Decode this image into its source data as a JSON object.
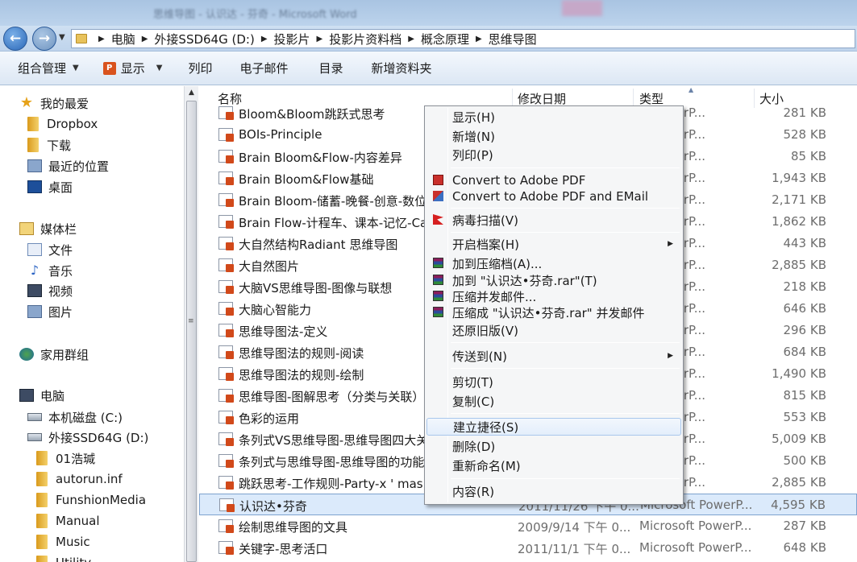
{
  "window": {
    "title": "思维导图 - 认识达 - 芬奇 - Microsoft Word"
  },
  "address": {
    "crumbs": [
      "电脑",
      "外接SSD64G (D:)",
      "投影片",
      "投影片资料档",
      "概念原理",
      "思维导图"
    ]
  },
  "toolbar": {
    "organize": "组合管理",
    "show": "显示",
    "print": "列印",
    "email": "电子邮件",
    "burn": "目录",
    "new_folder": "新增资料夹"
  },
  "sidebar": {
    "items": [
      {
        "label": "我的最爱",
        "icon": "star-icon"
      },
      {
        "label": "Dropbox",
        "icon": "folder-icon"
      },
      {
        "label": "下载",
        "icon": "folder-icon"
      },
      {
        "label": "最近的位置",
        "icon": "recent-places-icon"
      },
      {
        "label": "桌面",
        "icon": "desktop-icon"
      },
      {
        "label": "媒体栏",
        "icon": "library-icon"
      },
      {
        "label": "文件",
        "icon": "documents-icon"
      },
      {
        "label": "音乐",
        "icon": "music-icon"
      },
      {
        "label": "视频",
        "icon": "video-icon"
      },
      {
        "label": "图片",
        "icon": "pictures-icon"
      },
      {
        "label": "家用群组",
        "icon": "homegroup-icon"
      },
      {
        "label": "电脑",
        "icon": "computer-icon"
      },
      {
        "label": "本机磁盘 (C:)",
        "icon": "drive-icon"
      },
      {
        "label": "外接SSD64G (D:)",
        "icon": "drive-icon"
      },
      {
        "label": "01浩瑊",
        "icon": "folder-icon"
      },
      {
        "label": "autorun.inf",
        "icon": "folder-icon"
      },
      {
        "label": "FunshionMedia",
        "icon": "folder-icon"
      },
      {
        "label": "Manual",
        "icon": "folder-icon"
      },
      {
        "label": "Music",
        "icon": "folder-icon"
      },
      {
        "label": "Utility",
        "icon": "folder-icon"
      }
    ]
  },
  "columns": {
    "name": "名称",
    "date": "修改日期",
    "type": "类型",
    "size": "大小"
  },
  "files": [
    {
      "name": "Bloom&Bloom跳跃式思考",
      "date": "",
      "type": "ft PowerP...",
      "size": "281 KB"
    },
    {
      "name": "BOIs-Principle",
      "date": "",
      "type": "ft PowerP...",
      "size": "528 KB"
    },
    {
      "name": "Brain Bloom&Flow-内容差异",
      "date": "",
      "type": "ft PowerP...",
      "size": "85 KB"
    },
    {
      "name": "Brain Bloom&Flow基础",
      "date": "",
      "type": "ft PowerP...",
      "size": "1,943 KB"
    },
    {
      "name": "Brain Bloom-储蓄-晚餐-创意-数位",
      "date": "",
      "type": "ft PowerP...",
      "size": "2,171 KB"
    },
    {
      "name": "Brain Flow-计程车、课本-记忆-Ca",
      "date": "",
      "type": "ft PowerP...",
      "size": "1,862 KB"
    },
    {
      "name": "大自然结构Radiant 思维导图",
      "date": "",
      "type": "ft PowerP...",
      "size": "443 KB"
    },
    {
      "name": "大自然图片",
      "date": "",
      "type": "ft PowerP...",
      "size": "2,885 KB"
    },
    {
      "name": "大脑VS思维导图-图像与联想",
      "date": "",
      "type": "ft PowerP...",
      "size": "218 KB"
    },
    {
      "name": "大脑心智能力",
      "date": "",
      "type": "ft PowerP...",
      "size": "646 KB"
    },
    {
      "name": "思维导图法-定义",
      "date": "",
      "type": "ft PowerP...",
      "size": "296 KB"
    },
    {
      "name": "思维导图法的规则-阅读",
      "date": "",
      "type": "ft PowerP...",
      "size": "684 KB"
    },
    {
      "name": "思维导图法的规则-绘制",
      "date": "",
      "type": "ft PowerP...",
      "size": "1,490 KB"
    },
    {
      "name": "思维导图-图解思考（分类与关联）",
      "date": "",
      "type": "ft PowerP...",
      "size": "815 KB"
    },
    {
      "name": "色彩的运用",
      "date": "",
      "type": "ft PowerP...",
      "size": "553 KB"
    },
    {
      "name": "条列式VS思维导图-思维导图四大关",
      "date": "",
      "type": "ft PowerP...",
      "size": "5,009 KB"
    },
    {
      "name": "条列式与思维导图-思维导图的功能",
      "date": "",
      "type": "ft PowerP...",
      "size": "500 KB"
    },
    {
      "name": "跳跃思考-工作规则-Party-x ' mas",
      "date": "",
      "type": "ft PowerP...",
      "size": "2,885 KB"
    },
    {
      "name": "认识达•芬奇",
      "date": "2011/11/26 下午 0...",
      "type": "Microsoft PowerP...",
      "size": "4,595 KB",
      "selected": true
    },
    {
      "name": "绘制思维导图的文具",
      "date": "2009/9/14 下午 0...",
      "type": "Microsoft PowerP...",
      "size": "287 KB"
    },
    {
      "name": "关键字-思考活口",
      "date": "2011/11/1 下午 0...",
      "type": "Microsoft PowerP...",
      "size": "648 KB"
    }
  ],
  "context_menu": {
    "items": [
      {
        "label": "显示(H)",
        "name": "menu-show"
      },
      {
        "label": "新增(N)",
        "name": "menu-new"
      },
      {
        "label": "列印(P)",
        "name": "menu-print"
      },
      {
        "label": "Convert to Adobe PDF",
        "name": "menu-convert-pdf",
        "icon": "pdf-icon"
      },
      {
        "label": "Convert to Adobe PDF and EMail",
        "name": "menu-convert-pdf-email",
        "icon": "pdf-email-icon"
      },
      {
        "label": "病毒扫描(V)",
        "name": "menu-virus-scan",
        "icon": "antivirus-icon"
      },
      {
        "label": "开启档案(H)",
        "name": "menu-open-with",
        "submenu": true
      },
      {
        "label": "加到压缩档(A)...",
        "name": "menu-add-archive",
        "icon": "winrar-icon"
      },
      {
        "label": "加到 \"认识达•芬奇.rar\"(T)",
        "name": "menu-add-rar",
        "icon": "winrar-icon"
      },
      {
        "label": "压缩并发邮件...",
        "name": "menu-compress-email",
        "icon": "winrar-icon"
      },
      {
        "label": "压缩成 \"认识达•芬奇.rar\" 并发邮件",
        "name": "menu-compress-rar-email",
        "icon": "winrar-icon"
      },
      {
        "label": "还原旧版(V)",
        "name": "menu-restore"
      },
      {
        "label": "传送到(N)",
        "name": "menu-send-to",
        "submenu": true
      },
      {
        "label": "剪切(T)",
        "name": "menu-cut"
      },
      {
        "label": "复制(C)",
        "name": "menu-copy"
      },
      {
        "label": "建立捷径(S)",
        "name": "menu-create-shortcut",
        "hover": true
      },
      {
        "label": "删除(D)",
        "name": "menu-delete"
      },
      {
        "label": "重新命名(M)",
        "name": "menu-rename"
      },
      {
        "label": "内容(R)",
        "name": "menu-properties"
      }
    ]
  },
  "colors": {
    "selection": "#dbeafb",
    "selection_border": "#7da2ce",
    "toolbar": "#dce7f4",
    "menu_bg": "#f5f6f7"
  }
}
